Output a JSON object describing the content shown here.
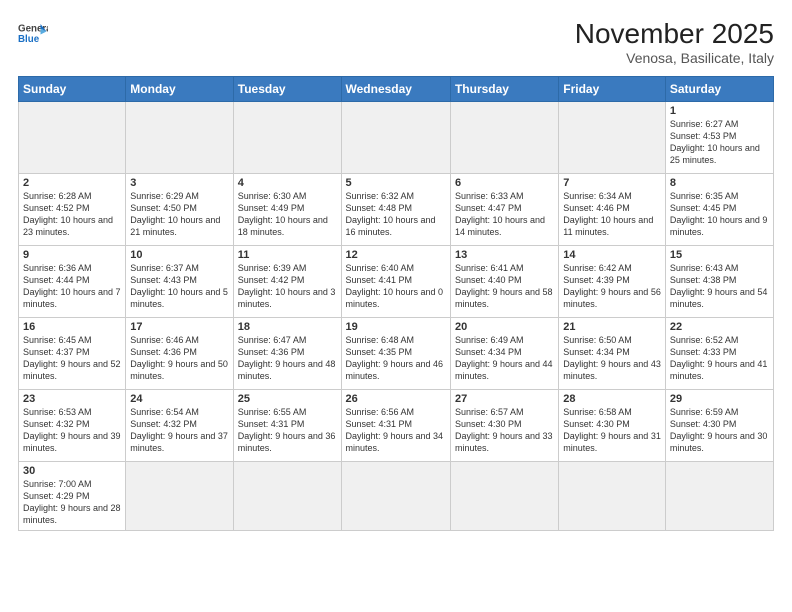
{
  "header": {
    "logo_general": "General",
    "logo_blue": "Blue",
    "title": "November 2025",
    "subtitle": "Venosa, Basilicate, Italy"
  },
  "weekdays": [
    "Sunday",
    "Monday",
    "Tuesday",
    "Wednesday",
    "Thursday",
    "Friday",
    "Saturday"
  ],
  "weeks": [
    [
      {
        "day": "",
        "info": "",
        "empty": true
      },
      {
        "day": "",
        "info": "",
        "empty": true
      },
      {
        "day": "",
        "info": "",
        "empty": true
      },
      {
        "day": "",
        "info": "",
        "empty": true
      },
      {
        "day": "",
        "info": "",
        "empty": true
      },
      {
        "day": "",
        "info": "",
        "empty": true
      },
      {
        "day": "1",
        "info": "Sunrise: 6:27 AM\nSunset: 4:53 PM\nDaylight: 10 hours\nand 25 minutes."
      }
    ],
    [
      {
        "day": "2",
        "info": "Sunrise: 6:28 AM\nSunset: 4:52 PM\nDaylight: 10 hours\nand 23 minutes."
      },
      {
        "day": "3",
        "info": "Sunrise: 6:29 AM\nSunset: 4:50 PM\nDaylight: 10 hours\nand 21 minutes."
      },
      {
        "day": "4",
        "info": "Sunrise: 6:30 AM\nSunset: 4:49 PM\nDaylight: 10 hours\nand 18 minutes."
      },
      {
        "day": "5",
        "info": "Sunrise: 6:32 AM\nSunset: 4:48 PM\nDaylight: 10 hours\nand 16 minutes."
      },
      {
        "day": "6",
        "info": "Sunrise: 6:33 AM\nSunset: 4:47 PM\nDaylight: 10 hours\nand 14 minutes."
      },
      {
        "day": "7",
        "info": "Sunrise: 6:34 AM\nSunset: 4:46 PM\nDaylight: 10 hours\nand 11 minutes."
      },
      {
        "day": "8",
        "info": "Sunrise: 6:35 AM\nSunset: 4:45 PM\nDaylight: 10 hours\nand 9 minutes."
      }
    ],
    [
      {
        "day": "9",
        "info": "Sunrise: 6:36 AM\nSunset: 4:44 PM\nDaylight: 10 hours\nand 7 minutes."
      },
      {
        "day": "10",
        "info": "Sunrise: 6:37 AM\nSunset: 4:43 PM\nDaylight: 10 hours\nand 5 minutes."
      },
      {
        "day": "11",
        "info": "Sunrise: 6:39 AM\nSunset: 4:42 PM\nDaylight: 10 hours\nand 3 minutes."
      },
      {
        "day": "12",
        "info": "Sunrise: 6:40 AM\nSunset: 4:41 PM\nDaylight: 10 hours\nand 0 minutes."
      },
      {
        "day": "13",
        "info": "Sunrise: 6:41 AM\nSunset: 4:40 PM\nDaylight: 9 hours\nand 58 minutes."
      },
      {
        "day": "14",
        "info": "Sunrise: 6:42 AM\nSunset: 4:39 PM\nDaylight: 9 hours\nand 56 minutes."
      },
      {
        "day": "15",
        "info": "Sunrise: 6:43 AM\nSunset: 4:38 PM\nDaylight: 9 hours\nand 54 minutes."
      }
    ],
    [
      {
        "day": "16",
        "info": "Sunrise: 6:45 AM\nSunset: 4:37 PM\nDaylight: 9 hours\nand 52 minutes."
      },
      {
        "day": "17",
        "info": "Sunrise: 6:46 AM\nSunset: 4:36 PM\nDaylight: 9 hours\nand 50 minutes."
      },
      {
        "day": "18",
        "info": "Sunrise: 6:47 AM\nSunset: 4:36 PM\nDaylight: 9 hours\nand 48 minutes."
      },
      {
        "day": "19",
        "info": "Sunrise: 6:48 AM\nSunset: 4:35 PM\nDaylight: 9 hours\nand 46 minutes."
      },
      {
        "day": "20",
        "info": "Sunrise: 6:49 AM\nSunset: 4:34 PM\nDaylight: 9 hours\nand 44 minutes."
      },
      {
        "day": "21",
        "info": "Sunrise: 6:50 AM\nSunset: 4:34 PM\nDaylight: 9 hours\nand 43 minutes."
      },
      {
        "day": "22",
        "info": "Sunrise: 6:52 AM\nSunset: 4:33 PM\nDaylight: 9 hours\nand 41 minutes."
      }
    ],
    [
      {
        "day": "23",
        "info": "Sunrise: 6:53 AM\nSunset: 4:32 PM\nDaylight: 9 hours\nand 39 minutes."
      },
      {
        "day": "24",
        "info": "Sunrise: 6:54 AM\nSunset: 4:32 PM\nDaylight: 9 hours\nand 37 minutes."
      },
      {
        "day": "25",
        "info": "Sunrise: 6:55 AM\nSunset: 4:31 PM\nDaylight: 9 hours\nand 36 minutes."
      },
      {
        "day": "26",
        "info": "Sunrise: 6:56 AM\nSunset: 4:31 PM\nDaylight: 9 hours\nand 34 minutes."
      },
      {
        "day": "27",
        "info": "Sunrise: 6:57 AM\nSunset: 4:30 PM\nDaylight: 9 hours\nand 33 minutes."
      },
      {
        "day": "28",
        "info": "Sunrise: 6:58 AM\nSunset: 4:30 PM\nDaylight: 9 hours\nand 31 minutes."
      },
      {
        "day": "29",
        "info": "Sunrise: 6:59 AM\nSunset: 4:30 PM\nDaylight: 9 hours\nand 30 minutes."
      }
    ],
    [
      {
        "day": "30",
        "info": "Sunrise: 7:00 AM\nSunset: 4:29 PM\nDaylight: 9 hours\nand 28 minutes.",
        "last": true
      },
      {
        "day": "",
        "info": "",
        "empty": true,
        "last": true
      },
      {
        "day": "",
        "info": "",
        "empty": true,
        "last": true
      },
      {
        "day": "",
        "info": "",
        "empty": true,
        "last": true
      },
      {
        "day": "",
        "info": "",
        "empty": true,
        "last": true
      },
      {
        "day": "",
        "info": "",
        "empty": true,
        "last": true
      },
      {
        "day": "",
        "info": "",
        "empty": true,
        "last": true
      }
    ]
  ]
}
